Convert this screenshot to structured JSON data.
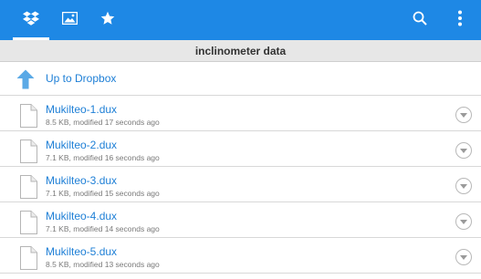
{
  "colors": {
    "action_bar": "#1e88e5",
    "link_text": "#1e7fd6",
    "title_bar": "#e7e7e7"
  },
  "tabs": [
    {
      "icon": "dropbox-icon",
      "selected": true
    },
    {
      "icon": "photos-icon",
      "selected": false
    },
    {
      "icon": "star-icon",
      "selected": false
    }
  ],
  "actions": [
    {
      "icon": "search-icon"
    },
    {
      "icon": "overflow-menu-icon"
    }
  ],
  "folder": {
    "title": "inclinometer data"
  },
  "up": {
    "label": "Up to Dropbox",
    "icon": "up-arrow-icon"
  },
  "files": [
    {
      "name": "Mukilteo-1.dux",
      "meta": "8.5 KB, modified 17 seconds ago"
    },
    {
      "name": "Mukilteo-2.dux",
      "meta": "7.1 KB, modified 16 seconds ago"
    },
    {
      "name": "Mukilteo-3.dux",
      "meta": "7.1 KB, modified 15 seconds ago"
    },
    {
      "name": "Mukilteo-4.dux",
      "meta": "7.1 KB, modified 14 seconds ago"
    },
    {
      "name": "Mukilteo-5.dux",
      "meta": "8.5 KB, modified 13 seconds ago"
    }
  ]
}
